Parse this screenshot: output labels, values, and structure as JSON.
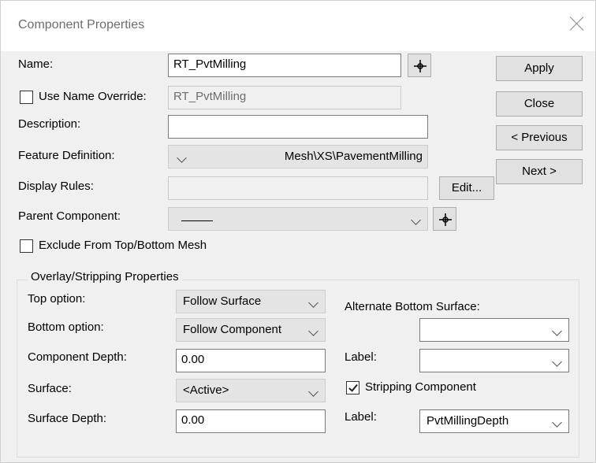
{
  "window": {
    "title": "Component Properties"
  },
  "fields": {
    "name_label": "Name:",
    "name_value": "RT_PvtMilling",
    "override_label": "Use Name Override:",
    "override_value": "RT_PvtMilling",
    "override_checked": false,
    "description_label": "Description:",
    "description_value": "",
    "feature_label": "Feature Definition:",
    "feature_value": "Mesh\\XS\\PavementMilling",
    "display_rules_label": "Display Rules:",
    "display_rules_value": "",
    "edit_button": "Edit...",
    "parent_label": "Parent Component:",
    "parent_value": "",
    "exclude_label": "Exclude From Top/Bottom Mesh",
    "exclude_checked": false
  },
  "buttons": {
    "apply": "Apply",
    "close": "Close",
    "previous": "< Previous",
    "next": "Next >"
  },
  "overlay": {
    "title": "Overlay/Stripping Properties",
    "top_option_label": "Top option:",
    "top_option_value": "Follow Surface",
    "bottom_option_label": "Bottom option:",
    "bottom_option_value": "Follow Component",
    "component_depth_label": "Component Depth:",
    "component_depth_value": "0.00",
    "surface_label": "Surface:",
    "surface_value": "<Active>",
    "surface_depth_label": "Surface Depth:",
    "surface_depth_value": "0.00",
    "alt_bottom_label": "Alternate Bottom Surface:",
    "alt_bottom_value": "",
    "label1_label": "Label:",
    "label1_value": "",
    "stripping_label": "Stripping Component",
    "stripping_checked": true,
    "label2_label": "Label:",
    "label2_value": "PvtMillingDepth"
  }
}
